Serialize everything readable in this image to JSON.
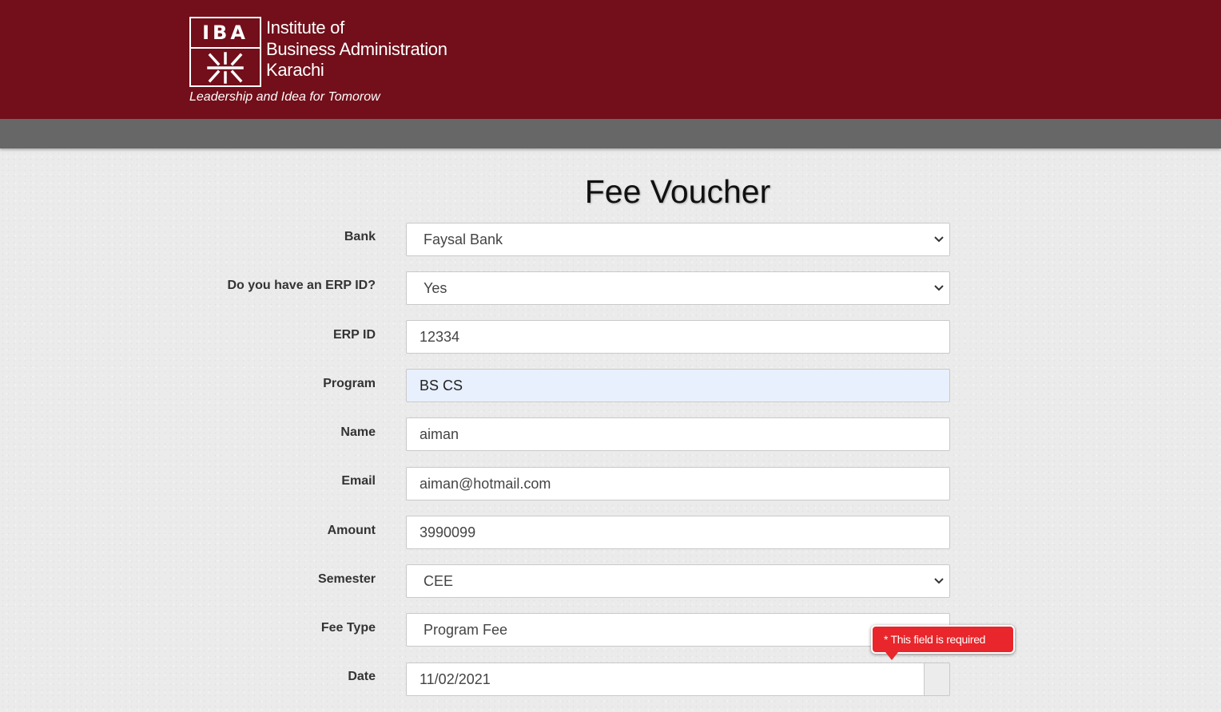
{
  "header": {
    "logo_letters": "IBA",
    "institute_lines": [
      "Institute of",
      "Business Administration",
      "Karachi"
    ],
    "tagline": "Leadership and Idea for Tomorow",
    "color": "#720f1a"
  },
  "navbar": {
    "color": "#676767"
  },
  "form": {
    "title": "Fee Voucher",
    "fields": [
      {
        "label": "Bank",
        "type": "select",
        "value": "Faysal Bank"
      },
      {
        "label": "Do you have an ERP ID?",
        "type": "select",
        "value": "Yes"
      },
      {
        "label": "ERP ID",
        "type": "text",
        "value": "12334"
      },
      {
        "label": "Program",
        "type": "text",
        "value": "BS CS"
      },
      {
        "label": "Name",
        "type": "text",
        "value": "aiman"
      },
      {
        "label": "Email",
        "type": "text",
        "value": "aiman@hotmail.com"
      },
      {
        "label": "Amount",
        "type": "text",
        "value": "3990099"
      },
      {
        "label": "Semester",
        "type": "select",
        "value": "CEE"
      },
      {
        "label": "Fee Type",
        "type": "select",
        "value": "Program Fee"
      },
      {
        "label": "Date",
        "type": "date",
        "value": "11/02/2021"
      }
    ],
    "validation_tooltip": "* This field is required",
    "error_color": "#e8262b"
  }
}
